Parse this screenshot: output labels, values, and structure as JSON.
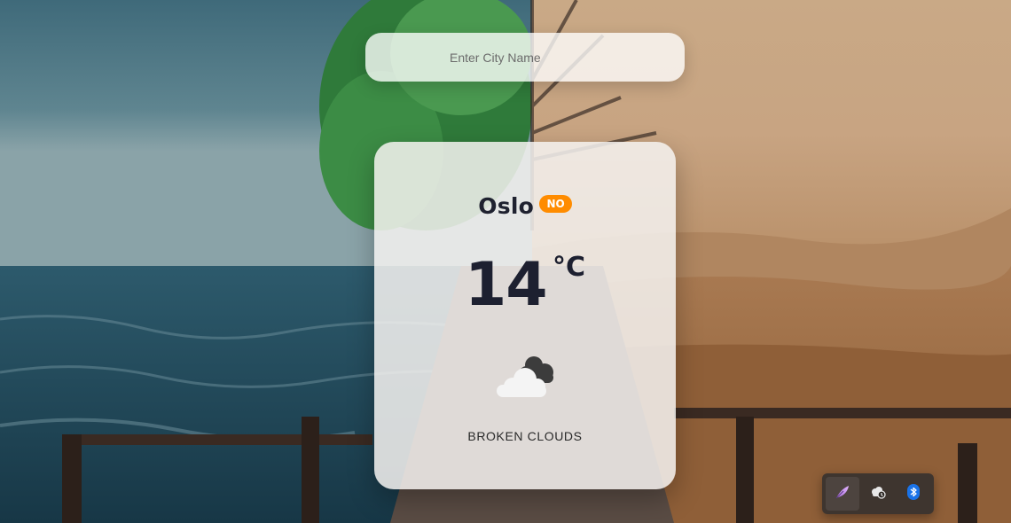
{
  "search": {
    "placeholder": "Enter City Name",
    "value": ""
  },
  "weather": {
    "city": "Oslo",
    "country_code": "NO",
    "temperature": "14",
    "unit": "°C",
    "description": "BROKEN CLOUDS",
    "icon": "broken-clouds-icon"
  },
  "tray": {
    "items": [
      {
        "icon": "feather-pen-icon",
        "active": true
      },
      {
        "icon": "cloud-sync-icon",
        "active": false
      },
      {
        "icon": "bluetooth-icon",
        "active": false
      }
    ]
  },
  "colors": {
    "badge": "#ff8c00",
    "text_dark": "#1f2230",
    "card_bg": "#f5f2f0"
  }
}
